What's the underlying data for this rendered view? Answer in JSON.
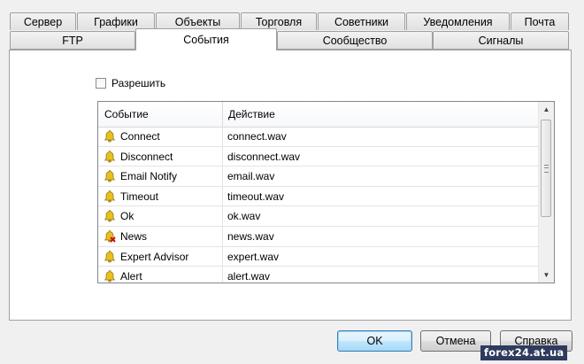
{
  "tabs": {
    "row1": [
      "Сервер",
      "Графики",
      "Объекты",
      "Торговля",
      "Советники",
      "Уведомления",
      "Почта"
    ],
    "row2": [
      "FTP",
      "События",
      "Сообщество",
      "Сигналы"
    ],
    "active": "События"
  },
  "enable_checkbox": {
    "label": "Разрешить",
    "checked": false
  },
  "events_table": {
    "columns": [
      "Событие",
      "Действие"
    ],
    "rows": [
      {
        "event": "Connect",
        "action": "connect.wav",
        "icon": "bell-icon"
      },
      {
        "event": "Disconnect",
        "action": "disconnect.wav",
        "icon": "bell-icon"
      },
      {
        "event": "Email Notify",
        "action": "email.wav",
        "icon": "bell-icon"
      },
      {
        "event": "Timeout",
        "action": "timeout.wav",
        "icon": "bell-icon"
      },
      {
        "event": "Ok",
        "action": "ok.wav",
        "icon": "bell-icon"
      },
      {
        "event": "News",
        "action": "news.wav",
        "icon": "bell-disabled-icon"
      },
      {
        "event": "Expert Advisor",
        "action": "expert.wav",
        "icon": "bell-icon"
      },
      {
        "event": "Alert",
        "action": "alert.wav",
        "icon": "bell-icon"
      }
    ]
  },
  "buttons": {
    "ok": "OK",
    "cancel": "Отмена",
    "help": "Справка"
  },
  "watermark": "forex24.at.ua",
  "colors": {
    "bell": "#e8c020",
    "disabled_mark": "#d01010",
    "ok_button_border": "#3c7fb1"
  }
}
